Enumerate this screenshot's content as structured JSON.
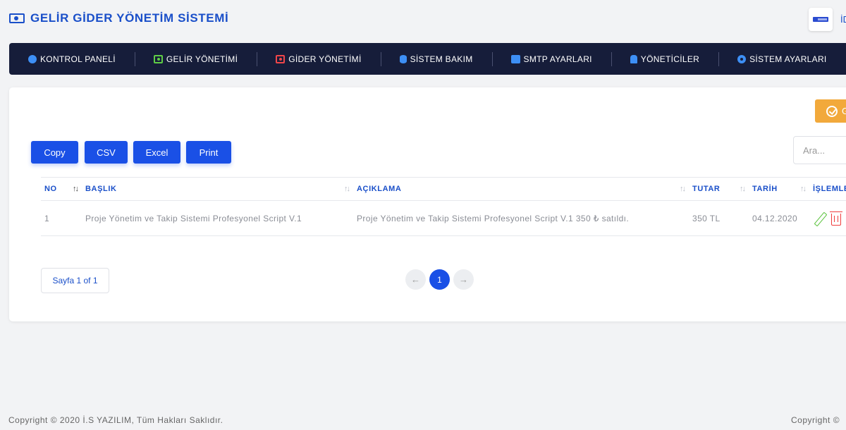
{
  "app": {
    "title": "GELİR GİDER YÖNETİM SİSTEMİ",
    "user_name": "İD"
  },
  "nav": {
    "items": [
      {
        "label": "KONTROL PANELİ",
        "icon": "dollar-circle-icon"
      },
      {
        "label": "GELİR YÖNETİMİ",
        "icon": "money-bill-green-icon"
      },
      {
        "label": "GİDER YÖNETİMİ",
        "icon": "money-bill-red-icon"
      },
      {
        "label": "SİSTEM BAKIM",
        "icon": "database-icon"
      },
      {
        "label": "SMTP AYARLARI",
        "icon": "mail-icon"
      },
      {
        "label": "YÖNETİCİLER",
        "icon": "user-icon"
      },
      {
        "label": "SİSTEM AYARLARI",
        "icon": "gear-icon"
      }
    ]
  },
  "toolbar": {
    "add_label": "G",
    "copy": "Copy",
    "csv": "CSV",
    "excel": "Excel",
    "print": "Print",
    "search_placeholder": "Ara..."
  },
  "table": {
    "columns": [
      "NO",
      "BAŞLIK",
      "AÇIKLAMA",
      "TUTAR",
      "TARİH",
      "İŞLEMLER"
    ],
    "rows": [
      {
        "no": "1",
        "title": "Proje Yönetim ve Takip Sistemi Profesyonel Script V.1",
        "desc": "Proje Yönetim ve Takip Sistemi Profesyonel Script V.1 350 ₺ satıldı.",
        "amount": "350 TL",
        "date": "04.12.2020"
      }
    ]
  },
  "pagination": {
    "info": "Sayfa 1 of 1",
    "prev": "←",
    "current": "1",
    "next": "→"
  },
  "footer": {
    "left": "Copyright © 2020 İ.S YAZILIM, Tüm Hakları Saklıdır.",
    "right": "Copyright ©"
  },
  "colors": {
    "primary": "#1a50e6",
    "nav_bg": "#161d3a",
    "add_button": "#f2a93b",
    "edit": "#58c23a",
    "delete": "#ef3d3d"
  }
}
